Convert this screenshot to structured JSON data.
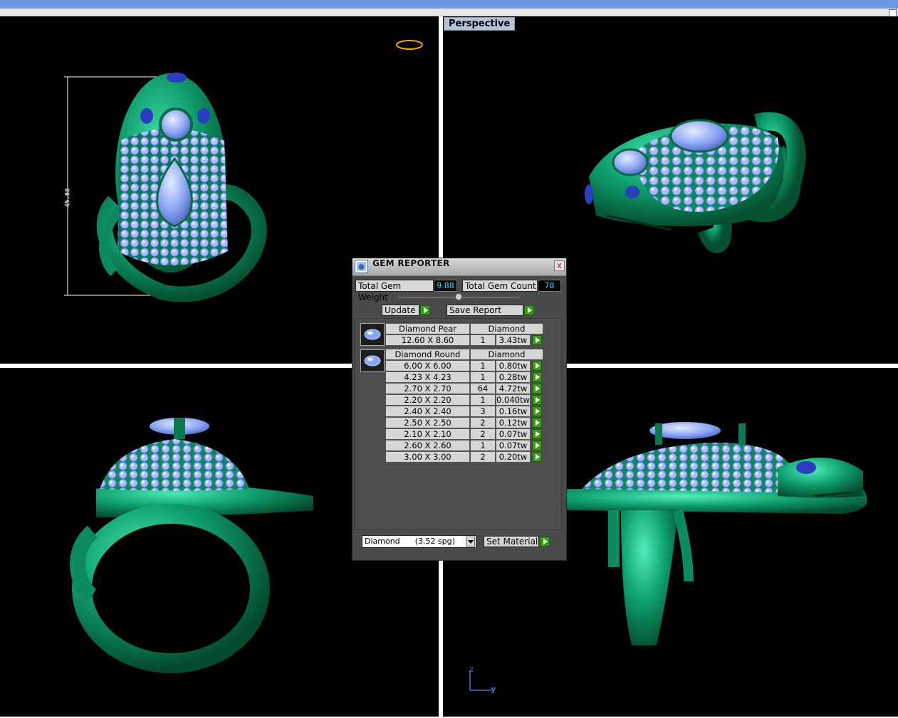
{
  "viewports": {
    "perspective_label": "Perspective",
    "dimension_label": "45.88",
    "axis_z": "z",
    "axis_y": "y"
  },
  "gem_reporter": {
    "title": "GEM REPORTER",
    "close": "x",
    "total_weight_label": "Total Gem Weight",
    "total_weight_value": "9.88",
    "total_count_label": "Total Gem Count",
    "total_count_value": "78",
    "update_label": "Update",
    "save_report_label": "Save Report",
    "groups": [
      {
        "shape": "Diamond Pear",
        "material": "Diamond",
        "rows": [
          {
            "size": "12.60 X 8.60",
            "count": "1",
            "weight": "3.43tw"
          }
        ]
      },
      {
        "shape": "Diamond Round",
        "material": "Diamond",
        "rows": [
          {
            "size": "6.00 X 6.00",
            "count": "1",
            "weight": "0.80tw"
          },
          {
            "size": "4.23 X 4.23",
            "count": "1",
            "weight": "0.28tw"
          },
          {
            "size": "2.70 X 2.70",
            "count": "64",
            "weight": "4.72tw"
          },
          {
            "size": "2.20 X 2.20",
            "count": "1",
            "weight": "0.040tw"
          },
          {
            "size": "2.40 X 2.40",
            "count": "3",
            "weight": "0.16tw"
          },
          {
            "size": "2.50 X 2.50",
            "count": "2",
            "weight": "0.12tw"
          },
          {
            "size": "2.10 X 2.10",
            "count": "2",
            "weight": "0.07tw"
          },
          {
            "size": "2.60 X 2.60",
            "count": "1",
            "weight": "0.07tw"
          },
          {
            "size": "3.00 X 3.00",
            "count": "2",
            "weight": "0.20tw"
          }
        ]
      }
    ],
    "material_select": "Diamond      (3.52 spg)",
    "set_material_label": "Set Material"
  }
}
